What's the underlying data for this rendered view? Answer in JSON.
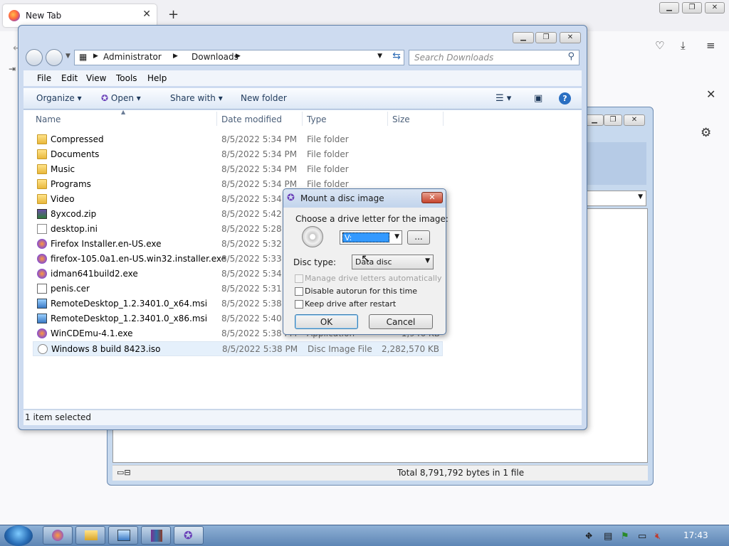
{
  "browser": {
    "tab_title": "New Tab",
    "tab_close": "✕",
    "new_tab": "+",
    "close_icon": "✕"
  },
  "explorer": {
    "breadcrumb": [
      "Administrator",
      "Downloads"
    ],
    "search_placeholder": "Search Downloads",
    "menu": [
      "File",
      "Edit",
      "View",
      "Tools",
      "Help"
    ],
    "commands": {
      "organize": "Organize",
      "open": "Open",
      "share_with": "Share with",
      "new_folder": "New folder"
    },
    "columns": {
      "name": "Name",
      "date": "Date modified",
      "type": "Type",
      "size": "Size"
    },
    "rows": [
      {
        "name": "Compressed",
        "date": "8/5/2022 5:34 PM",
        "type": "File folder",
        "size": "",
        "icon": "folder"
      },
      {
        "name": "Documents",
        "date": "8/5/2022 5:34 PM",
        "type": "File folder",
        "size": "",
        "icon": "folder"
      },
      {
        "name": "Music",
        "date": "8/5/2022 5:34 PM",
        "type": "File folder",
        "size": "",
        "icon": "folder"
      },
      {
        "name": "Programs",
        "date": "8/5/2022 5:34 PM",
        "type": "File folder",
        "size": "",
        "icon": "folder"
      },
      {
        "name": "Video",
        "date": "8/5/2022 5:34 PM",
        "type": "",
        "size": "",
        "icon": "folder"
      },
      {
        "name": "8yxcod.zip",
        "date": "8/5/2022 5:42 PM",
        "type": "",
        "size": "",
        "icon": "zip"
      },
      {
        "name": "desktop.ini",
        "date": "8/5/2022 5:28 PM",
        "type": "",
        "size": "",
        "icon": "ini"
      },
      {
        "name": "Firefox Installer.en-US.exe",
        "date": "8/5/2022 5:32 PM",
        "type": "",
        "size": "",
        "icon": "exe"
      },
      {
        "name": "firefox-105.0a1.en-US.win32.installer.exe",
        "date": "8/5/2022 5:33 PM",
        "type": "",
        "size": "",
        "icon": "exe"
      },
      {
        "name": "idman641build2.exe",
        "date": "8/5/2022 5:34 PM",
        "type": "",
        "size": "",
        "icon": "exe"
      },
      {
        "name": "penis.cer",
        "date": "8/5/2022 5:31 PM",
        "type": "",
        "size": "",
        "icon": "cer"
      },
      {
        "name": "RemoteDesktop_1.2.3401.0_x64.msi",
        "date": "8/5/2022 5:38 PM",
        "type": "",
        "size": "",
        "icon": "msi"
      },
      {
        "name": "RemoteDesktop_1.2.3401.0_x86.msi",
        "date": "8/5/2022 5:40 PM",
        "type": "",
        "size": "",
        "icon": "msi"
      },
      {
        "name": "WinCDEmu-4.1.exe",
        "date": "8/5/2022 5:38 PM",
        "type": "Application",
        "size": "1,946 KB",
        "icon": "exe"
      },
      {
        "name": "Windows 8 build 8423.iso",
        "date": "8/5/2022 5:38 PM",
        "type": "Disc Image File",
        "size": "2,282,570 KB",
        "icon": "iso",
        "selected": true
      }
    ],
    "status": "1 item selected"
  },
  "window2": {
    "status_total": "Total 8,791,792 bytes in 1 file"
  },
  "dialog": {
    "title": "Mount a disc image",
    "drive_prompt": "Choose a drive letter for the image:",
    "drive_value": "V:",
    "browse": "...",
    "disc_type_label": "Disc type:",
    "disc_type_value": "Data disc",
    "manage_letters": "Manage drive letters automatically",
    "disable_autorun": "Disable autorun for this time",
    "keep_drive": "Keep drive after restart",
    "ok": "OK",
    "cancel": "Cancel"
  },
  "taskbar": {
    "clock": "17:43"
  }
}
